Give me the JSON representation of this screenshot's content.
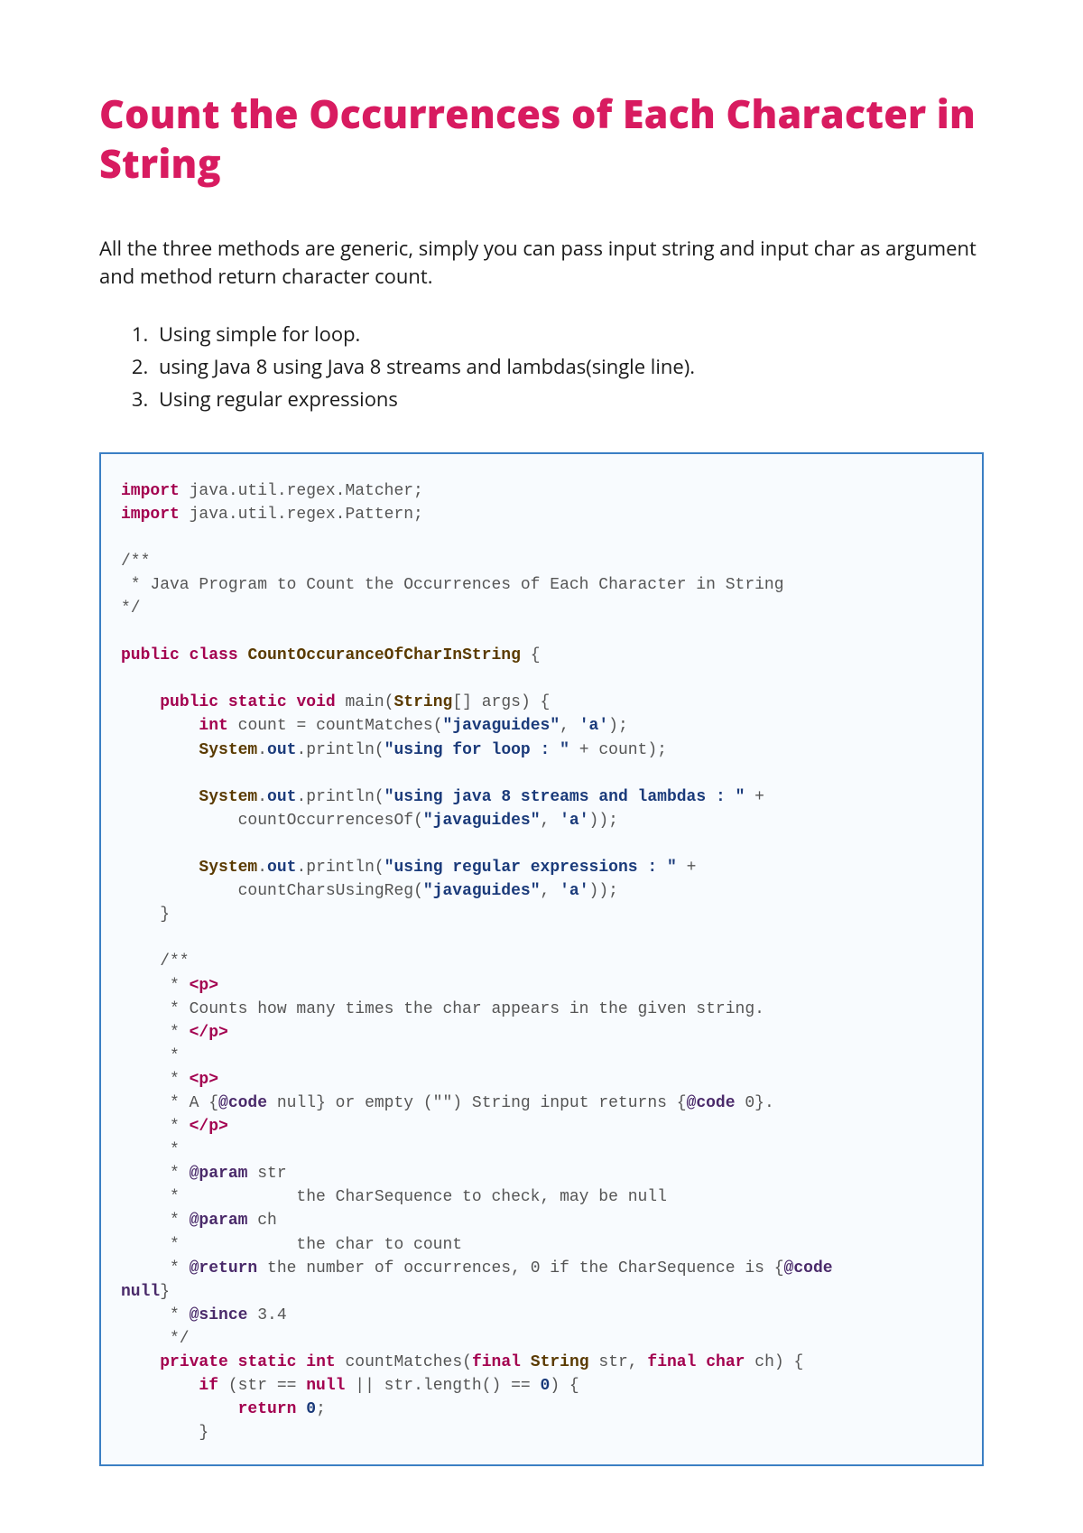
{
  "title": "Count the Occurrences of Each Character in String",
  "intro": "All the three methods are generic, simply you can pass input string and input char as argument and method return character count.",
  "list": {
    "item1": "Using simple for loop.",
    "item2": "using Java 8 using Java 8 streams and lambdas(single line).",
    "item3": "Using regular expressions"
  },
  "code": {
    "import1_pkg": " java.util.regex.Matcher;",
    "import2_pkg": " java.util.regex.Pattern;",
    "c1": "/**",
    "c2": " * Java Program to Count the Occurrences of Each Character in String",
    "c3": "*/",
    "className": "CountOccuranceOfCharInString",
    "mainArgs": "args",
    "countVar": "count",
    "m_countMatches": "countMatches",
    "sysOut": "System",
    "outField": "out",
    "println": "println",
    "str_javaguides": "\"javaguides\"",
    "char_a": "'a'",
    "str_forloop": "\"using for loop : \"",
    "str_java8": "\"using java 8 streams and lambdas : \"",
    "m_countOcc": "countOccurrencesOf",
    "str_regex": "\"using regular expressions : \"",
    "m_countReg": "countCharsUsingReg",
    "jc1": "    /**",
    "jc2": "     * ",
    "p_open": "<p>",
    "jc3": "     * Counts how many times the char appears in the given string.",
    "jc4": "     * ",
    "p_close": "</p>",
    "jc5": "     *",
    "jc6": "     * A {",
    "at_code": "@code",
    "null_word": " null",
    "jc6b": "} or empty (\"\") String input returns {",
    "zero_word": " 0",
    "jc6c": "}.",
    "at_param": "@param",
    "param_str": " str",
    "param_str_desc": "     *            the CharSequence to check, may be null",
    "param_ch": " ch",
    "param_ch_desc": "     *            the char to count",
    "at_return": "@return",
    "return_desc": " the number of occurrences, 0 if the CharSequence is {",
    "at_since": "@since",
    "since_ver": " 3.4",
    "jc_end": "     */",
    "String": "String",
    "str_arg": "str",
    "ch_arg": "ch",
    "length_call": "length",
    "zero": "0"
  }
}
